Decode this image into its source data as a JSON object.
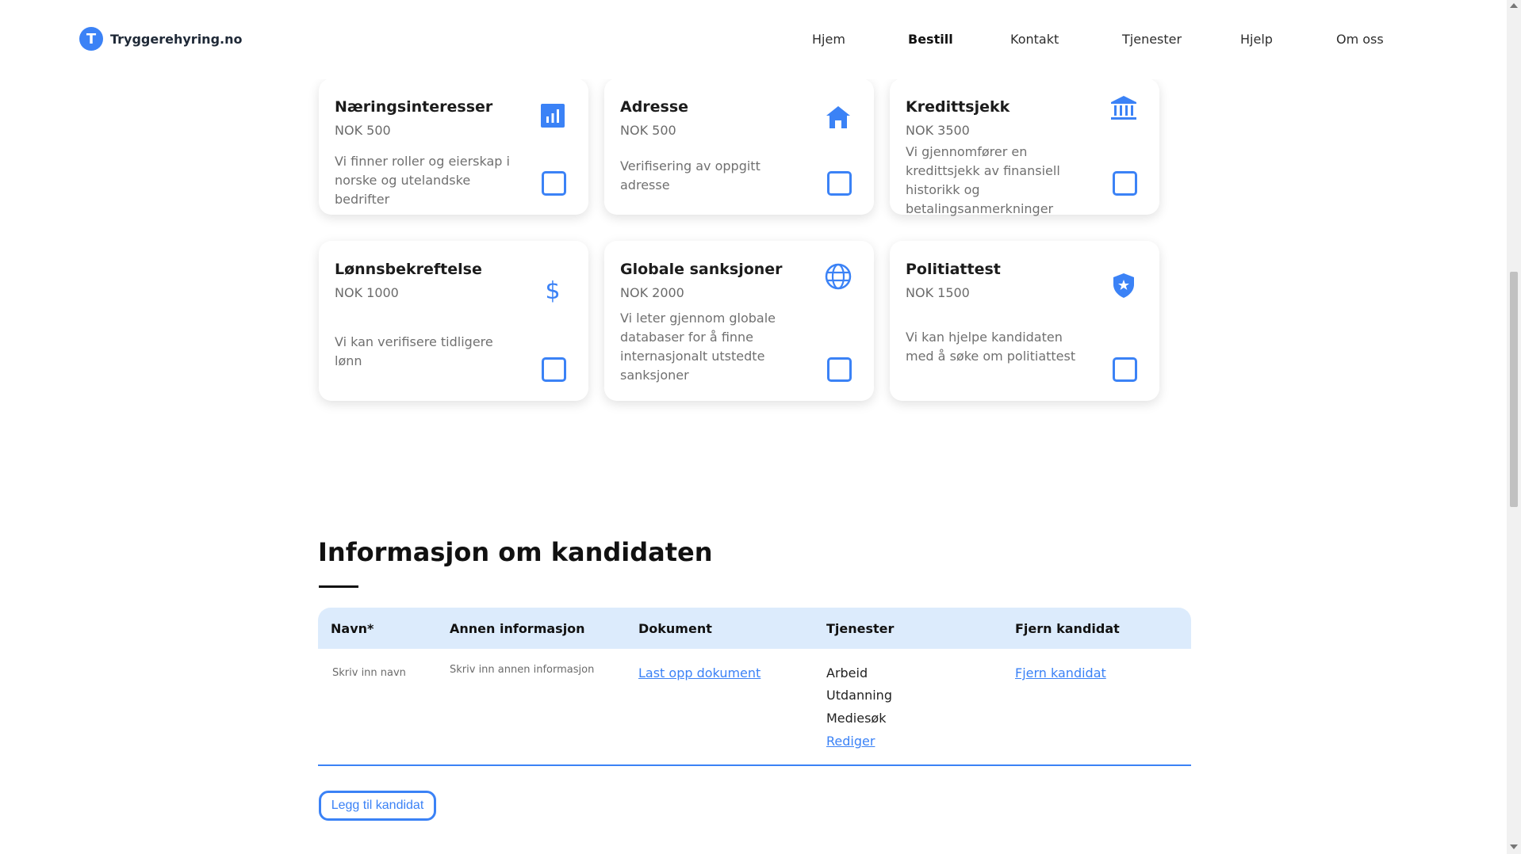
{
  "brand": {
    "logo_letter": "T",
    "name": "Tryggerehyring.no",
    "accent": "#3b82f6"
  },
  "nav": [
    "Hjem",
    "Bestill",
    "Kontakt",
    "Tjenester",
    "Hjelp",
    "Om oss"
  ],
  "nav_active": "Bestill",
  "cards": [
    {
      "title": "Næringsinteresser",
      "price": "NOK 500",
      "description": "Vi finner roller og eierskap i norske og utelandske bedrifter",
      "icon": "bar-chart-icon",
      "checked": false
    },
    {
      "title": "Adresse",
      "price": "NOK 500",
      "description": "Verifisering av oppgitt adresse",
      "icon": "home-icon",
      "checked": false
    },
    {
      "title": "Kredittsjekk",
      "price": "NOK 3500",
      "description": "Vi gjennomfører en kredittsjekk av finansiell historikk og betalingsanmerkninger",
      "icon": "bank-icon",
      "checked": false
    },
    {
      "title": "Lønnsbekreftelse",
      "price": "NOK 1000",
      "description": "Vi kan verifisere tidligere lønn",
      "icon": "dollar-icon",
      "checked": false
    },
    {
      "title": "Globale sanksjoner",
      "price": "NOK 2000",
      "description": "Vi leter gjennom globale databaser for å finne internasjonalt utstedte sanksjoner",
      "icon": "globe-icon",
      "checked": false
    },
    {
      "title": "Politiattest",
      "price": "NOK 1500",
      "description": "Vi kan hjelpe kandidaten med å søke om politiattest",
      "icon": "police-shield-icon",
      "checked": false
    }
  ],
  "candidate_section": {
    "title": "Informasjon om kandidaten",
    "columns": [
      "Navn*",
      "Annen informasjon",
      "Dokument",
      "Tjenester",
      "Fjern kandidat"
    ],
    "row": {
      "name_placeholder": "Skriv inn navn",
      "info_placeholder": "Skriv inn annen informasjon",
      "document_link": "Last opp dokument",
      "services": [
        "Arbeid",
        "Utdanning",
        "Mediesøk"
      ],
      "edit_link": "Rediger",
      "remove_link": "Fjern kandidat"
    },
    "add_button": "Legg til kandidat"
  }
}
